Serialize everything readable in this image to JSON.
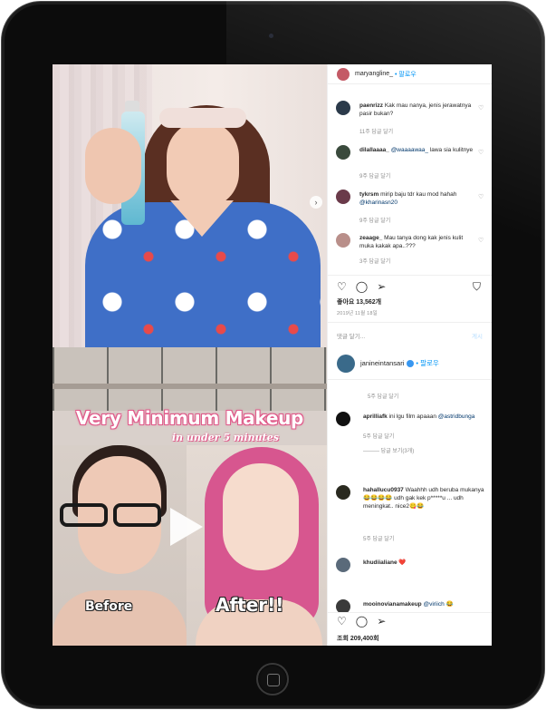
{
  "post1": {
    "username": "maryangline_",
    "follow": "• 팔로우",
    "comments": [
      {
        "user": "paenrizz",
        "text": "Kak mau nanya, jenis jerawatnya pasir bukan?",
        "mention": "",
        "after": "",
        "meta": "11주   답글 달기",
        "avatar_color": "#2b3a4a"
      },
      {
        "user": "dilallaaaa_",
        "text": "",
        "mention": "@waaaawaa_",
        "after": " lawa sia kulitnye",
        "meta": "9주   답글 달기",
        "avatar_color": "#3a4a3c"
      },
      {
        "user": "tykrsm",
        "text": "mirip baju tdr kau mod hahah ",
        "mention": "@kharinasn20",
        "after": "",
        "meta": "9주   답글 달기",
        "avatar_color": "#6a3a4a"
      },
      {
        "user": "zeaage_",
        "text": "Mau tanya dong kak jenis kulit muka kakak apa..???",
        "mention": "",
        "after": "",
        "meta": "3주   답글 달기",
        "avatar_color": "#b98f8a"
      }
    ],
    "likes": "좋아요 13,562개",
    "date": "2019년 11월 18일",
    "add_comment": "댓글 달기...",
    "post_button": "게시"
  },
  "post2": {
    "username": "janineintansari",
    "follow": "• 팔로우",
    "video_title": "Very Minimum Makeup",
    "video_subtitle": "in under 5 minutes",
    "label_before": "Before",
    "label_after": "After!!",
    "top_meta": "5주   답글 달기",
    "comments": [
      {
        "user": "aprilliafk",
        "text": "ini lgu film apaaan ",
        "mention": "@astridbunga",
        "meta": "5주   답글 달기",
        "avatar_color": "#111111",
        "extra": "———   답글 보기(3개)"
      },
      {
        "user": "hahaIlucu0937",
        "text": "Waahhh udh beruba mukanya😂😂😂😂 udh gak kek p*****u ... udh meningkat.. nice2😋😂",
        "mention": "",
        "meta": "5주   답글 달기",
        "avatar_color": "#2a2a20",
        "extra": ""
      },
      {
        "user": "khudiialiane",
        "text": "❤️",
        "mention": "",
        "meta": "",
        "avatar_color": "#5a6a7a",
        "extra": ""
      },
      {
        "user": "mooinovianamakeup",
        "text": "",
        "mention": "@viriich",
        "meta": "",
        "avatar_color": "#3a3a3a",
        "extra": "😂"
      }
    ],
    "views": "조회 209,400회"
  },
  "icons": {
    "heart": "heart-icon",
    "comment": "comment-icon",
    "share": "share-icon",
    "bookmark": "bookmark-icon",
    "next": "chevron-right-icon"
  }
}
